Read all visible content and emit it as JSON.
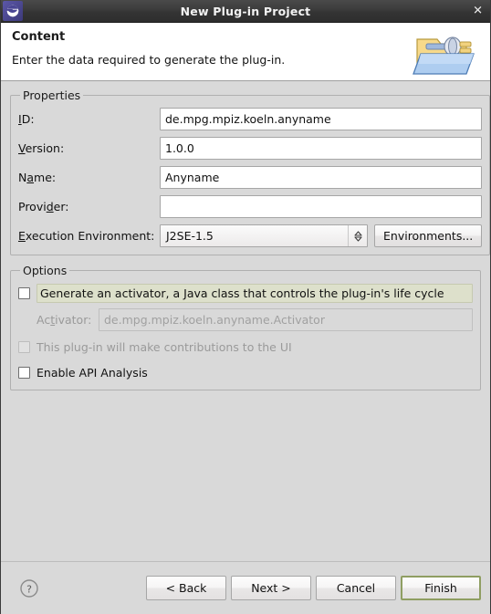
{
  "window": {
    "title": "New Plug-in Project",
    "app_icon": "eclipse-icon",
    "close_label": "✕"
  },
  "header": {
    "title": "Content",
    "description": "Enter the data required to generate the plug-in.",
    "graphic": "plugin-folder-icon"
  },
  "properties": {
    "legend": "Properties",
    "fields": [
      {
        "label": "ID:",
        "value": "de.mpg.mpiz.koeln.anyname",
        "placeholder": ""
      },
      {
        "label": "Version:",
        "value": "1.0.0",
        "placeholder": ""
      },
      {
        "label": "Name:",
        "value": "Anyname",
        "placeholder": ""
      },
      {
        "label": "Provider:",
        "value": "",
        "placeholder": ""
      }
    ],
    "execution_environment": {
      "label": "Execution Environment:",
      "value": "J2SE-1.5",
      "button_label": "Environments..."
    }
  },
  "options": {
    "legend": "Options",
    "generate_activator": {
      "label": "Generate an activator, a Java class that controls the plug-in's life cycle",
      "checked": false,
      "highlight_color": "#dde0cb"
    },
    "activator": {
      "label": "Activator:",
      "value": "de.mpg.mpiz.koeln.anyname.Activator",
      "enabled": false
    },
    "ui_contributions": {
      "label": "This plug-in will make contributions to the UI",
      "checked": false,
      "enabled": false
    },
    "api_analysis": {
      "label": "Enable API Analysis",
      "checked": false,
      "enabled": true
    }
  },
  "footer": {
    "help_label": "?",
    "buttons": [
      {
        "name": "back",
        "label": "< Back"
      },
      {
        "name": "next",
        "label": "Next >"
      },
      {
        "name": "cancel",
        "label": "Cancel"
      },
      {
        "name": "finish",
        "label": "Finish"
      }
    ]
  },
  "colors": {
    "window_bg": "#d9d9d9",
    "header_bg": "#ffffff",
    "titlebar_bg": "#3b3b3b",
    "default_button_border": "#8f9e62"
  }
}
